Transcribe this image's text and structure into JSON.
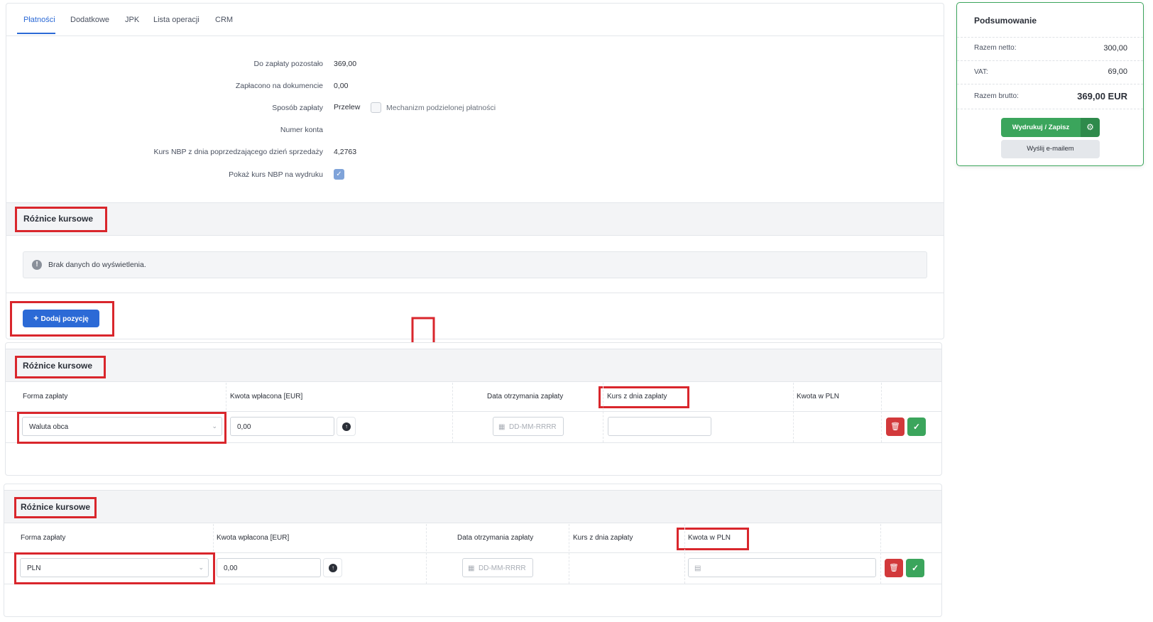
{
  "tabs": [
    {
      "label": "Płatności",
      "active": true
    },
    {
      "label": "Dodatkowe"
    },
    {
      "label": "JPK"
    },
    {
      "label": "Lista operacji"
    },
    {
      "label": "CRM"
    }
  ],
  "form": {
    "remaining_label": "Do zapłaty pozostało",
    "remaining_value": "369,00",
    "paid_label": "Zapłacono na dokumencie",
    "paid_value": "0,00",
    "method_label": "Sposób zapłaty",
    "method_value": "Przelew",
    "split_payment_label": "Mechanizm podzielonej płatności",
    "split_payment_checked": false,
    "account_label": "Numer konta",
    "account_value": "",
    "nbp_rate_label": "Kurs NBP z dnia poprzedzającego dzień sprzedaży",
    "nbp_rate_value": "4,2763",
    "show_nbp_label": "Pokaż kurs NBP na wydruku",
    "show_nbp_checked": true
  },
  "section1": {
    "title": "Różnice kursowe",
    "empty_message": "Brak danych do wyświetlenia.",
    "add_button": "Dodaj pozycję"
  },
  "table_headers": {
    "form": "Forma zapłaty",
    "amount": "Kwota wpłacona [EUR]",
    "date": "Data otrzymania zapłaty",
    "rate": "Kurs z dnia zapłaty",
    "pln": "Kwota w PLN"
  },
  "section2": {
    "title": "Różnice kursowe",
    "form_value": "Waluta obca",
    "amount_value": "0,00",
    "date_placeholder": "DD-MM-RRRR",
    "rate_value": ""
  },
  "section3": {
    "title": "Różnice kursowe",
    "form_value": "PLN",
    "amount_value": "0,00",
    "date_placeholder": "DD-MM-RRRR",
    "pln_value": ""
  },
  "summary": {
    "title": "Podsumowanie",
    "net_label": "Razem netto:",
    "net_value": "300,00",
    "vat_label": "VAT:",
    "vat_value": "69,00",
    "gross_label": "Razem brutto:",
    "gross_value": "369,00 EUR",
    "print_button": "Wydrukuj / Zapisz",
    "email_button": "Wyślij e-mailem"
  },
  "colors": {
    "accent": "#2c6ad6",
    "success": "#3ba55c",
    "danger": "#d2393b",
    "annotation": "#d9262c"
  }
}
